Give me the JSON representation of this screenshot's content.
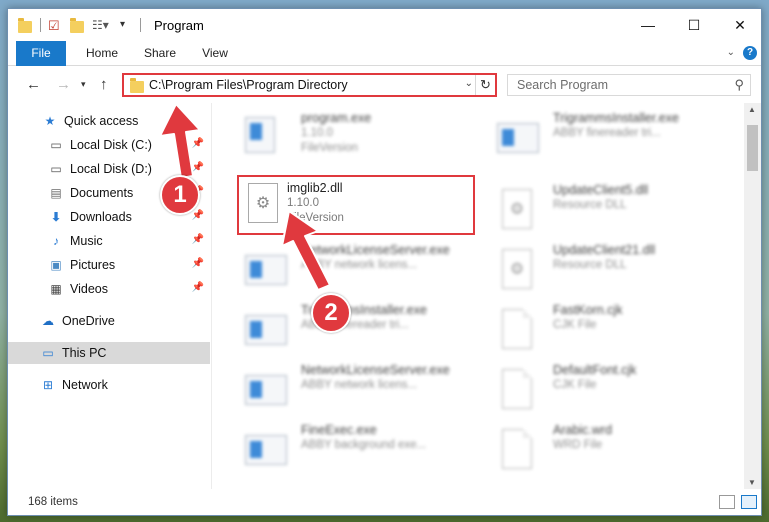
{
  "window": {
    "title": "Program",
    "controls": {
      "minimize": "—",
      "maximize": "☐",
      "close": "✕"
    }
  },
  "ribbon": {
    "tabs": [
      "File",
      "Home",
      "Share",
      "View"
    ]
  },
  "address": {
    "path": "C:\\Program Files\\Program Directory",
    "search_placeholder": "Search Program"
  },
  "sidebar": {
    "items": [
      {
        "label": "Quick access",
        "icon": "star-icon",
        "pinned": false
      },
      {
        "label": "Local Disk (C:)",
        "icon": "drive-icon",
        "pinned": true
      },
      {
        "label": "Local Disk (D:)",
        "icon": "drive-icon",
        "pinned": true
      },
      {
        "label": "Documents",
        "icon": "documents-icon",
        "pinned": true
      },
      {
        "label": "Downloads",
        "icon": "download-icon",
        "pinned": true
      },
      {
        "label": "Music",
        "icon": "music-icon",
        "pinned": true
      },
      {
        "label": "Pictures",
        "icon": "pictures-icon",
        "pinned": true
      },
      {
        "label": "Videos",
        "icon": "videos-icon",
        "pinned": true
      },
      {
        "label": "OneDrive",
        "icon": "cloud-icon",
        "pinned": false
      },
      {
        "label": "This PC",
        "icon": "computer-icon",
        "pinned": false,
        "selected": true
      },
      {
        "label": "Network",
        "icon": "network-icon",
        "pinned": false
      }
    ]
  },
  "files": {
    "left": [
      {
        "name": "program.exe",
        "line1": "1.10.0",
        "line2": "FileVersion",
        "type": "exe",
        "blurred": true
      },
      {
        "name": "imglib2.dll",
        "line1": "1.10.0",
        "line2": "FileVersion",
        "type": "dll",
        "blurred": false,
        "highlighted": true
      },
      {
        "name": "NetworkLicenseServer.exe",
        "line1": "ABBY network licens...",
        "line2": "",
        "type": "exe",
        "blurred": true
      },
      {
        "name": "TrigrammsInstaller.exe",
        "line1": "ABBY finereader tri...",
        "line2": "",
        "type": "exe",
        "blurred": true
      },
      {
        "name": "NetworkLicenseServer.exe",
        "line1": "ABBY network licens...",
        "line2": "",
        "type": "exe",
        "blurred": true
      },
      {
        "name": "FineExec.exe",
        "line1": "ABBY background exe...",
        "line2": "",
        "type": "exe",
        "blurred": true
      }
    ],
    "right": [
      {
        "name": "TrigrammsInstaller.exe",
        "line1": "ABBY finereader tri...",
        "line2": "",
        "type": "exe",
        "blurred": true
      },
      {
        "name": "UpdateClient5.dll",
        "line1": "Resource DLL",
        "line2": "",
        "type": "dll",
        "blurred": true
      },
      {
        "name": "UpdateClient21.dll",
        "line1": "Resource DLL",
        "line2": "",
        "type": "dll",
        "blurred": true
      },
      {
        "name": "FastKorn.cjk",
        "line1": "CJK File",
        "line2": "",
        "type": "doc",
        "blurred": true
      },
      {
        "name": "DefaultFont.cjk",
        "line1": "CJK File",
        "line2": "",
        "type": "doc",
        "blurred": true
      },
      {
        "name": "Arabic.wrd",
        "line1": "WRD File",
        "line2": "",
        "type": "doc",
        "blurred": true
      }
    ]
  },
  "status": {
    "item_count": "168 items"
  },
  "callouts": {
    "one": "1",
    "two": "2"
  },
  "colors": {
    "accent": "#1979ca",
    "highlight": "#e0393e",
    "selected": "#d9d9d9"
  }
}
